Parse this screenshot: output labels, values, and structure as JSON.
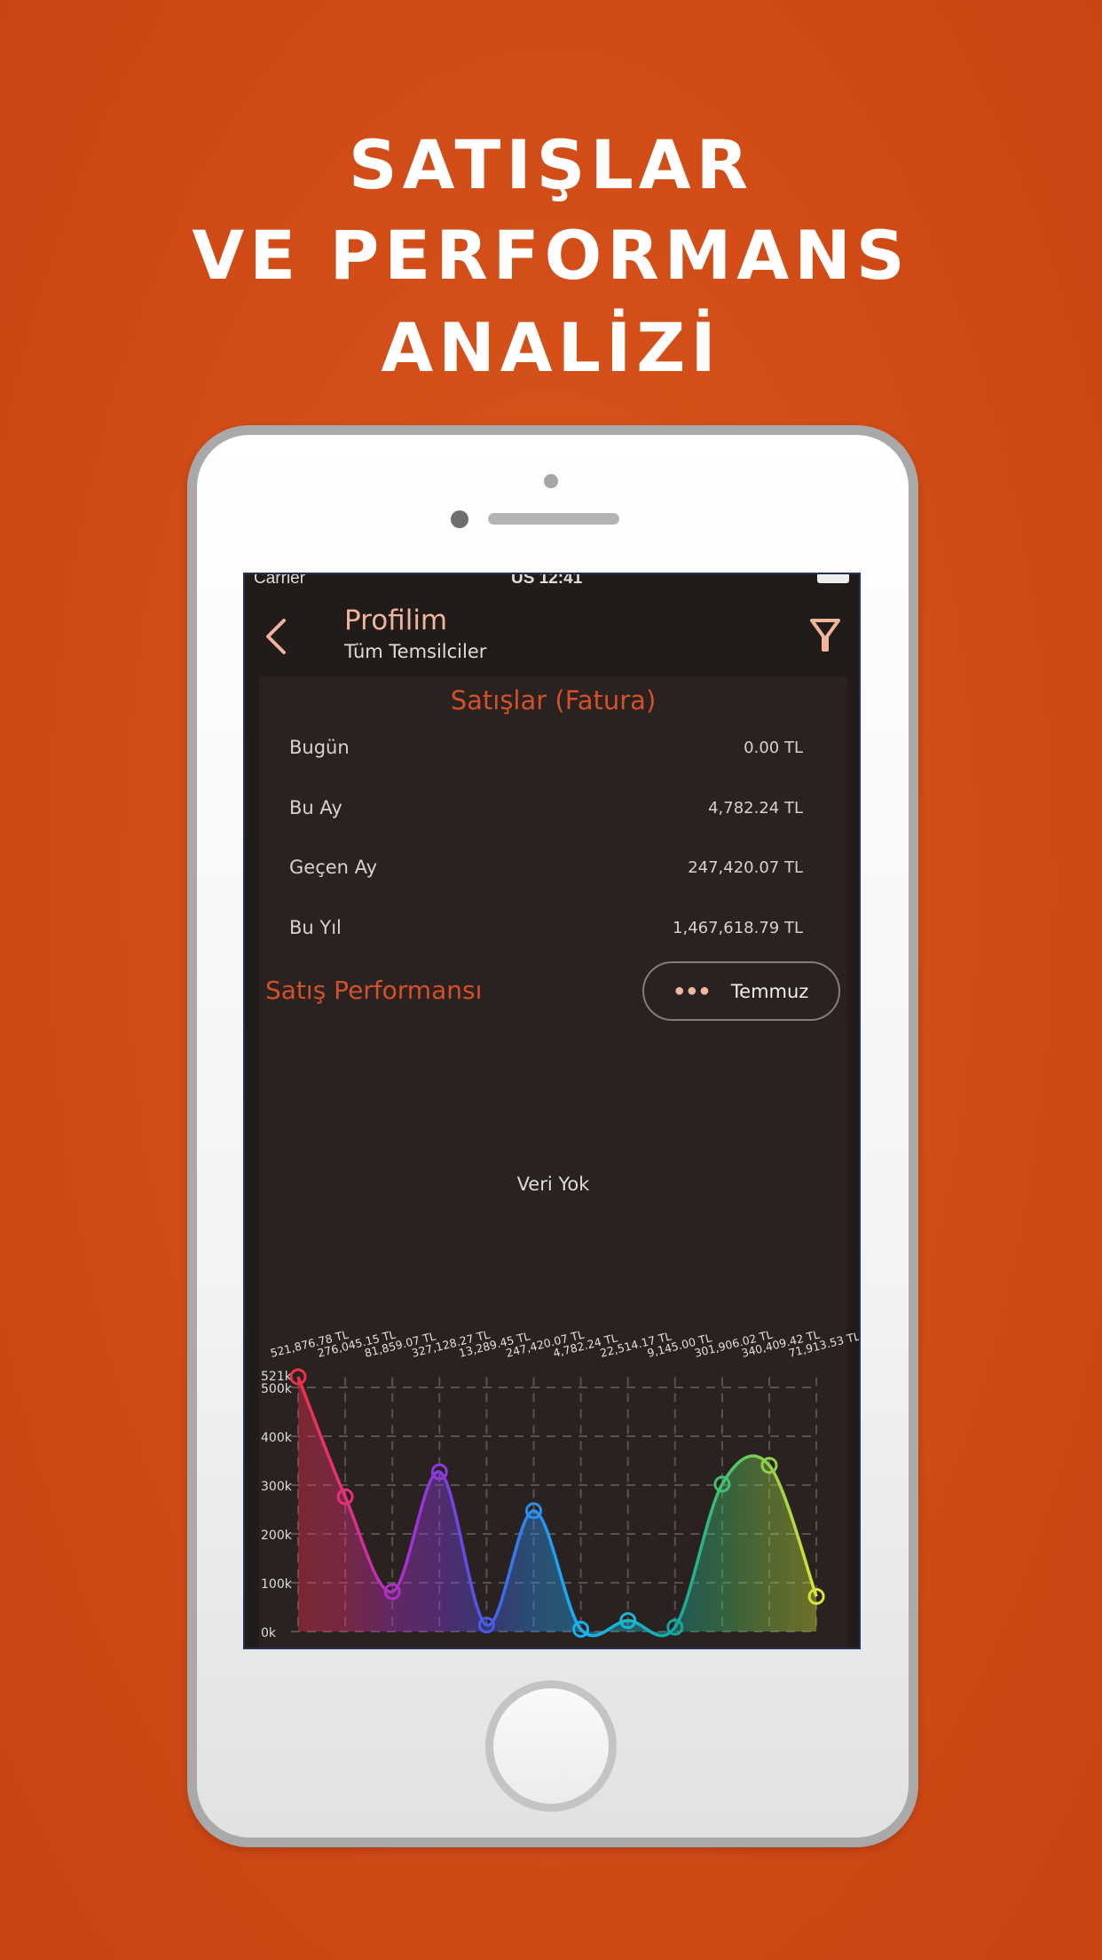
{
  "headline": [
    "SATIŞLAR",
    "VE PERFORMANS",
    "ANALİZİ"
  ],
  "status_bar": {
    "carrier": "Carrier",
    "time": "US 12:41"
  },
  "header": {
    "title": "Profilim",
    "subtitle": "Tüm Temsilciler",
    "back_icon": "chevron-left-icon",
    "filter_icon": "filter-icon"
  },
  "sales": {
    "title": "Satışlar (Fatura)",
    "rows": [
      {
        "label": "Bugün",
        "value": "0.00 TL"
      },
      {
        "label": "Bu Ay",
        "value": "4,782.24 TL"
      },
      {
        "label": "Geçen Ay",
        "value": "247,420.07 TL"
      },
      {
        "label": "Bu Yıl",
        "value": "1,467,618.79 TL"
      }
    ]
  },
  "performance": {
    "title": "Satış Performansı",
    "month_button": "Temmuz",
    "empty_text": "Veri Yok"
  },
  "colors": {
    "accent": "#d2502a",
    "background": "#d04a16",
    "screen": "#211b1a"
  },
  "chart_data": {
    "type": "area",
    "y_ticks": [
      "0k",
      "100k",
      "200k",
      "300k",
      "400k",
      "500k"
    ],
    "max_label": "521k",
    "ylim": [
      0,
      521876.78
    ],
    "grid": true,
    "values": [
      521876.78,
      276045.15,
      81859.07,
      327128.27,
      13289.45,
      247420.07,
      4782.24,
      22514.17,
      9145.0,
      301906.02,
      340409.42,
      71913.53
    ],
    "labels": [
      "521,876.78 TL",
      "276,045.15 TL",
      "81,859.07 TL",
      "327,128.27 TL",
      "13,289.45 TL",
      "247,420.07 TL",
      "4,782.24 TL",
      "22,514.17 TL",
      "9,145.00 TL",
      "301,906.02 TL",
      "340,409.42 TL",
      "71,913.53 TL"
    ],
    "point_colors": [
      "#f0304a",
      "#e8307a",
      "#b030c8",
      "#8a3ae0",
      "#4a5ae8",
      "#2a90f0",
      "#18b0f0",
      "#18b8d0",
      "#14a8a0",
      "#40c070",
      "#90d048",
      "#d8e438"
    ]
  }
}
